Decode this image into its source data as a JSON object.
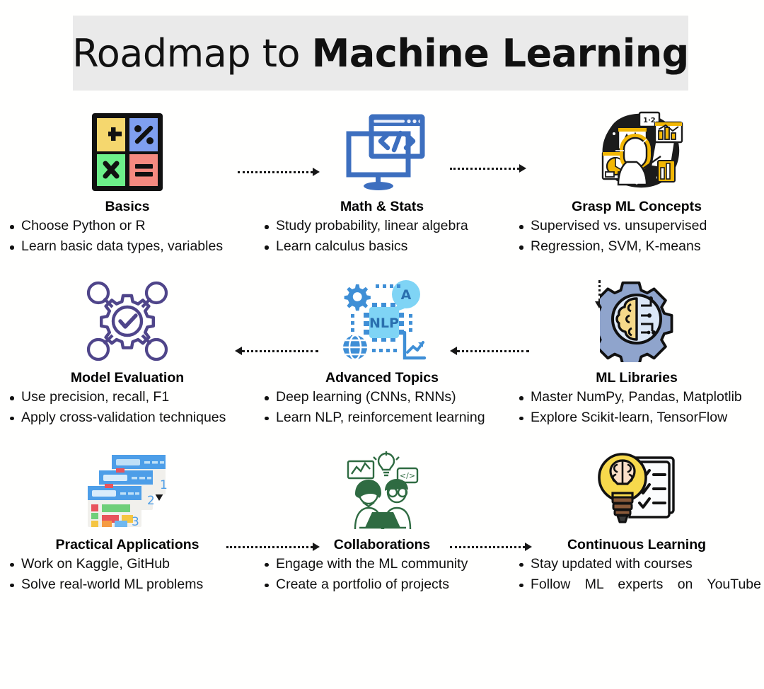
{
  "title": {
    "light": "Roadmap to ",
    "bold": "Machine Learning"
  },
  "steps": [
    {
      "id": "basics",
      "icon": "calculator-grid-icon",
      "title": "Basics",
      "bullets": [
        "Choose Python or R",
        "Learn basic data types, variables"
      ]
    },
    {
      "id": "math-stats",
      "icon": "code-monitor-icon",
      "title": "Math & Stats",
      "bullets": [
        "Study probability, linear algebra",
        "Learn calculus basics"
      ]
    },
    {
      "id": "grasp-ml-concepts",
      "icon": "data-scientist-dashboard-icon",
      "title": "Grasp ML Concepts",
      "bullets": [
        "Supervised vs. unsupervised",
        "Regression, SVM, K-means"
      ]
    },
    {
      "id": "model-evaluation",
      "icon": "gear-check-network-icon",
      "title": "Model Evaluation",
      "bullets": [
        "Use precision, recall, F1",
        "Apply cross-validation techniques"
      ]
    },
    {
      "id": "advanced-topics",
      "icon": "nlp-chip-icon",
      "title": "Advanced Topics",
      "bullets": [
        "Deep learning (CNNs, RNNs)",
        "Learn NLP, reinforcement learning"
      ]
    },
    {
      "id": "ml-libraries",
      "icon": "gear-brain-circuit-icon",
      "title": "ML Libraries",
      "bullets": [
        "Master NumPy, Pandas, Matplotlib",
        "Explore Scikit-learn, TensorFlow"
      ]
    },
    {
      "id": "practical-applications",
      "icon": "stacked-boards-icon",
      "title": "Practical Applications",
      "bullets": [
        "Work on Kaggle, GitHub",
        "Solve real-world ML problems"
      ]
    },
    {
      "id": "collaborations",
      "icon": "team-laptop-icon",
      "title": "Collaborations",
      "bullets": [
        "Engage with the ML community",
        "Create a portfolio of projects"
      ]
    },
    {
      "id": "continuous-learning",
      "icon": "brain-bulb-checklist-icon",
      "title": "Continuous Learning",
      "bullets": [
        "Stay updated with courses",
        "Follow ML experts on YouTube"
      ]
    }
  ],
  "connectors": [
    {
      "id": "basics-to-math",
      "direction": "right"
    },
    {
      "id": "math-to-grasp",
      "direction": "right"
    },
    {
      "id": "grasp-to-mllibraries",
      "direction": "down"
    },
    {
      "id": "mllibraries-to-advanced",
      "direction": "left"
    },
    {
      "id": "advanced-to-modeleval",
      "direction": "left"
    },
    {
      "id": "modeleval-to-practical",
      "direction": "down"
    },
    {
      "id": "practical-to-collaborations",
      "direction": "right"
    },
    {
      "id": "collaborations-to-continuous",
      "direction": "right"
    }
  ],
  "palette": {
    "title_band": "#eaeaea",
    "page_bg": "#fffffe",
    "text": "#111111",
    "calc_yellow": "#f5d76e",
    "calc_blue": "#7f9ff0",
    "calc_green": "#6df08a",
    "calc_red": "#f58a80",
    "monitor_blue": "#3d6fbf",
    "scientist_yellow": "#f2b705",
    "gear_purple": "#4f458a",
    "nlp_blue": "#4d9ee8",
    "nlp_cyan": "#7fd4f5",
    "mllib_steel": "#8fa4cc",
    "mllib_brain": "#f5d98a",
    "board_blue": "#4d9ee8",
    "team_green": "#2f6b42",
    "bulb_yellow": "#f7d94c"
  }
}
